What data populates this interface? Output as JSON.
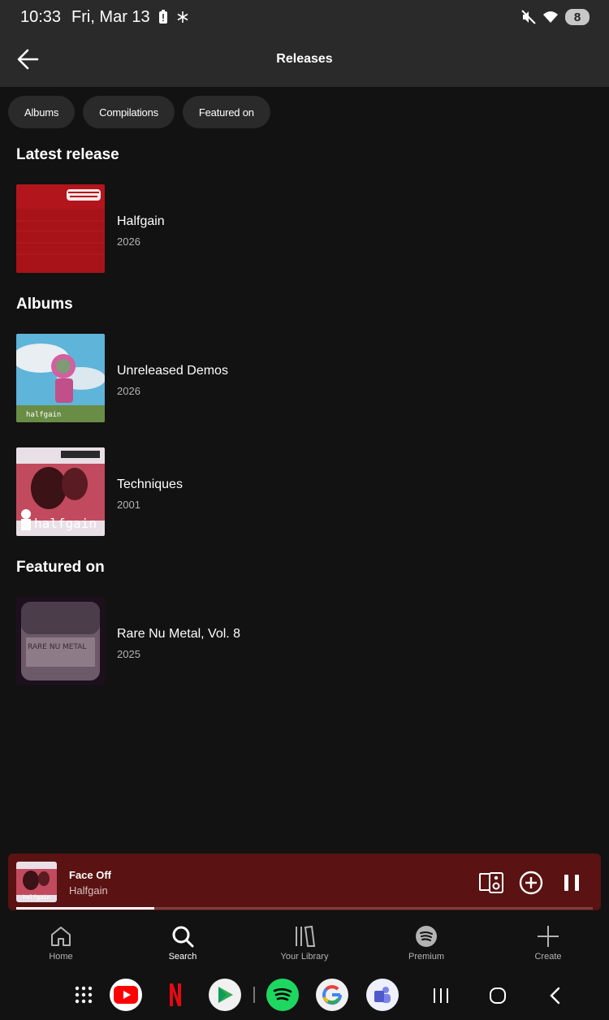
{
  "status": {
    "time": "10:33",
    "date": "Fri, Mar 13",
    "battery": "8"
  },
  "header": {
    "title": "Releases"
  },
  "chips": [
    "Albums",
    "Compilations",
    "Featured on"
  ],
  "sections": {
    "latest": {
      "title": "Latest release",
      "items": [
        {
          "title": "Halfgain",
          "year": "2026",
          "cover": "halfgain-red-cover"
        }
      ]
    },
    "albums": {
      "title": "Albums",
      "items": [
        {
          "title": "Unreleased Demos",
          "year": "2026",
          "cover": "unreleased-demos-cover"
        },
        {
          "title": "Techniques",
          "year": "2001",
          "cover": "techniques-cover"
        }
      ]
    },
    "featured": {
      "title": "Featured on",
      "items": [
        {
          "title": "Rare Nu Metal, Vol. 8",
          "year": "2025",
          "cover": "rare-nu-metal-cover"
        }
      ]
    }
  },
  "player": {
    "title": "Face Off",
    "artist": "Halfgain",
    "progress": 0.24,
    "accent": "#5a1212"
  },
  "nav": {
    "items": [
      {
        "label": "Home",
        "icon": "home-icon"
      },
      {
        "label": "Search",
        "icon": "search-icon",
        "active": true
      },
      {
        "label": "Your Library",
        "icon": "library-icon"
      },
      {
        "label": "Premium",
        "icon": "spotify-icon"
      },
      {
        "label": "Create",
        "icon": "plus-icon"
      }
    ]
  },
  "dock": {
    "apps": [
      "app-drawer-icon",
      "youtube-icon",
      "netflix-icon",
      "play-games-icon",
      "spotify-icon",
      "google-icon",
      "teams-icon"
    ],
    "system": [
      "recents-icon",
      "home-button-icon",
      "back-icon"
    ]
  }
}
